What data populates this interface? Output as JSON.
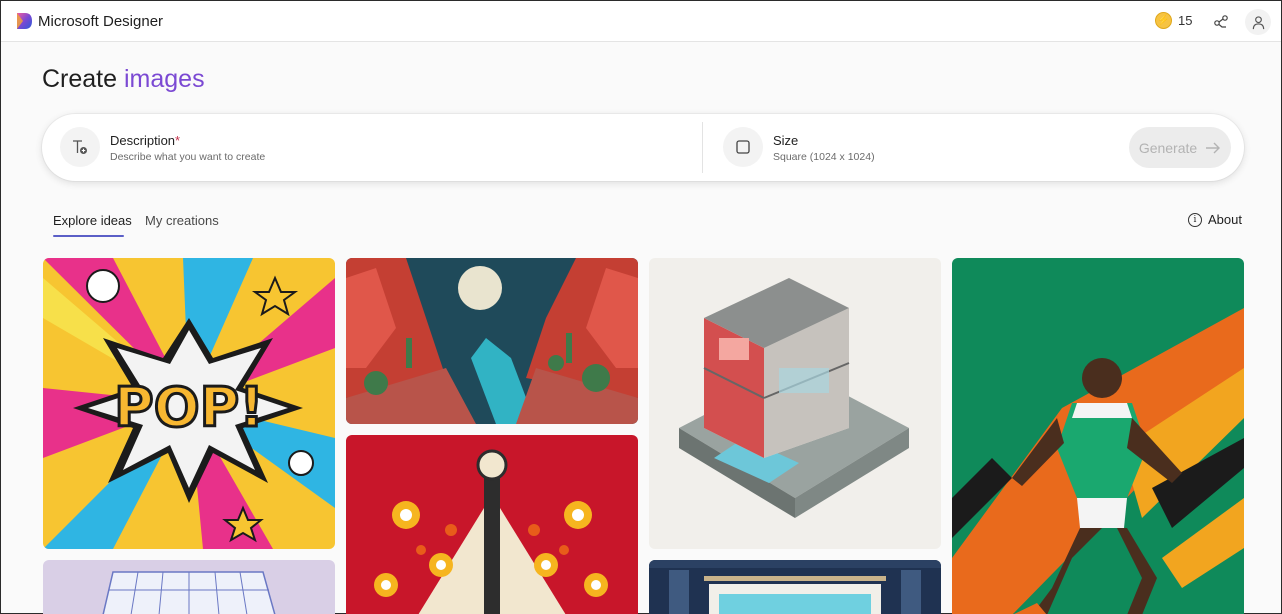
{
  "header": {
    "app_title": "Microsoft Designer",
    "coin_count": "15",
    "coin_icon": "lightning-coin-icon",
    "share_icon": "share-icon",
    "account_icon": "person-icon"
  },
  "page": {
    "title_prefix": "Create",
    "title_accent": "images",
    "accent_color": "#7b49d3"
  },
  "prompt": {
    "description_label": "Description",
    "description_required": "*",
    "description_placeholder": "Describe what you want to create",
    "size_label": "Size",
    "size_value": "Square (1024 x 1024)",
    "generate_label": "Generate"
  },
  "tabs": {
    "explore": "Explore ideas",
    "mine": "My creations",
    "about": "About"
  },
  "gallery": [
    {
      "name": "pop-art-card"
    },
    {
      "name": "desert-canyon-card"
    },
    {
      "name": "isometric-house-card"
    },
    {
      "name": "soccer-player-card"
    },
    {
      "name": "folk-guitar-card"
    },
    {
      "name": "glass-pavilion-card"
    },
    {
      "name": "pool-room-card"
    }
  ]
}
